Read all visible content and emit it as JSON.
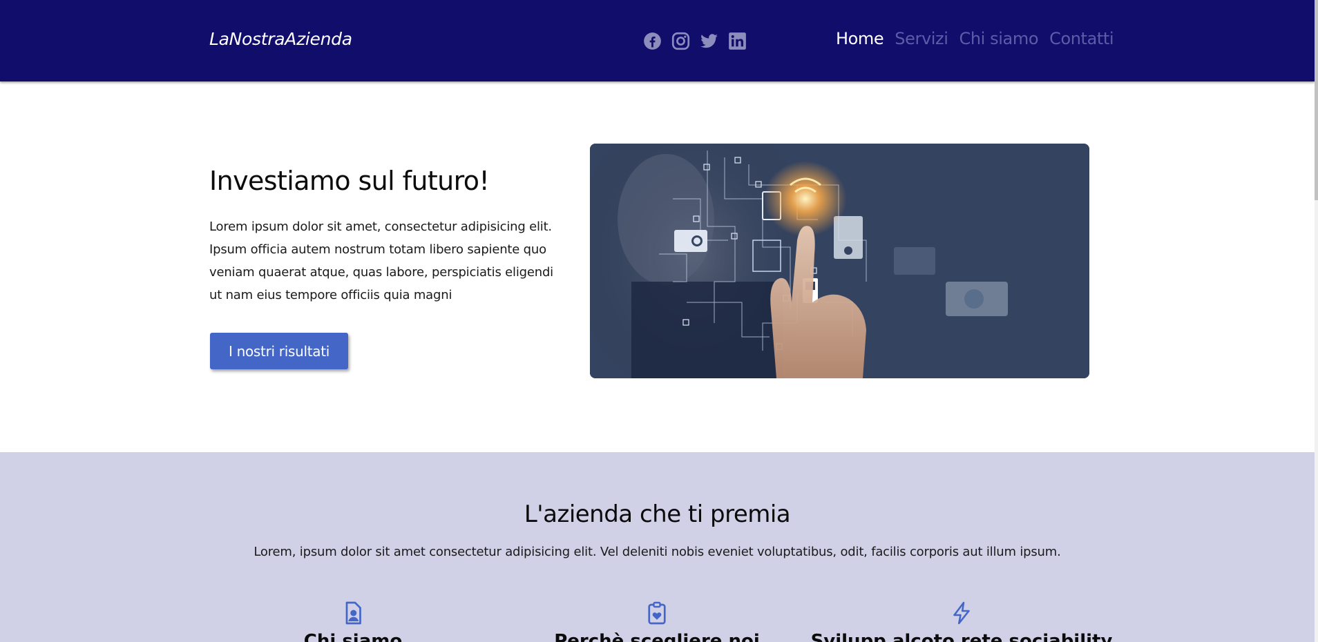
{
  "header": {
    "brand": "LaNostraAzienda",
    "social_icons": [
      "facebook-icon",
      "instagram-icon",
      "twitter-icon",
      "linkedin-icon"
    ],
    "nav": [
      {
        "label": "Home",
        "active": true
      },
      {
        "label": "Servizi",
        "active": false
      },
      {
        "label": "Chi siamo",
        "active": false
      },
      {
        "label": "Contatti",
        "active": false
      }
    ]
  },
  "hero": {
    "title": "Investiamo sul futuro!",
    "text": "Lorem ipsum dolor sit amet, consectetur adipisicing elit. Ipsum officia autem nostrum totam libero sapiente quo veniam quaerat atque, quas labore, perspiciatis eligendi ut nam eius tempore officiis quia magni",
    "button_label": "I nostri risultati"
  },
  "section2": {
    "title": "L'azienda che ti premia",
    "text": "Lorem, ipsum dolor sit amet consectetur adipisicing elit. Vel deleniti nobis eveniet voluptatibus, odit, facilis corporis aut illum ipsum.",
    "features": [
      {
        "icon": "person-badge-icon",
        "title": "Chi siamo"
      },
      {
        "icon": "clipboard-heart-icon",
        "title": "Perchè scegliere noi"
      },
      {
        "icon": "lightning-icon",
        "title": "Svilupp alcoto rete sociability"
      }
    ]
  },
  "colors": {
    "navbar_bg": "#100d6b",
    "nav_active": "#ffffff",
    "nav_inactive": "#5c5ca8",
    "button_bg": "#4466c6",
    "section2_bg": "#d0d1e6",
    "icon_accent": "#4466c6"
  }
}
